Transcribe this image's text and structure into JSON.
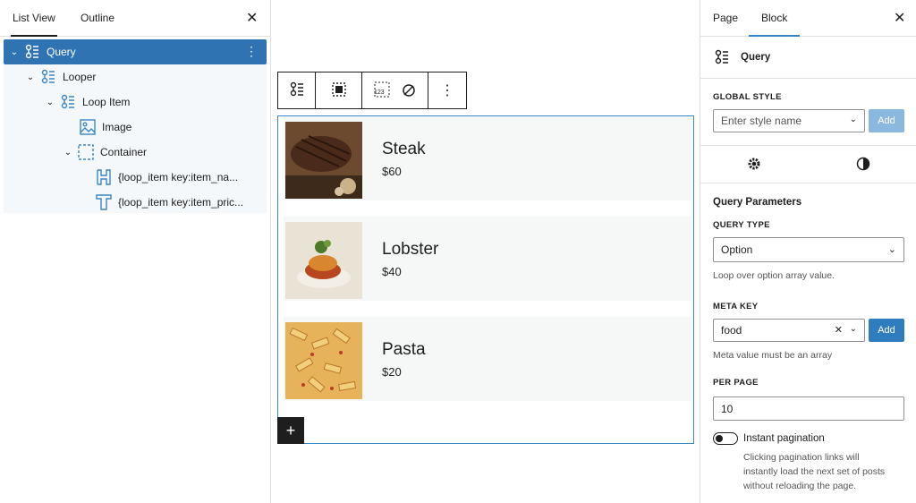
{
  "left_panel": {
    "tabs": [
      "List View",
      "Outline"
    ],
    "close_symbol": "✕",
    "tree": [
      {
        "label": "Query",
        "icon": "query-icon",
        "chevron": "⌄",
        "selected": true
      },
      {
        "label": "Looper",
        "icon": "looper-icon",
        "chevron": "⌄"
      },
      {
        "label": "Loop Item",
        "icon": "loop-item-icon",
        "chevron": "⌄"
      },
      {
        "label": "Image",
        "icon": "image-icon",
        "chevron": ""
      },
      {
        "label": "Container",
        "icon": "container-icon",
        "chevron": "⌄"
      },
      {
        "label": "{loop_item key:item_na...",
        "icon": "heading-icon",
        "chevron": ""
      },
      {
        "label": "{loop_item key:item_pric...",
        "icon": "text-icon",
        "chevron": ""
      }
    ],
    "more_symbol": "⋮"
  },
  "canvas": {
    "toolbar_more": "⋮",
    "add_symbol": "+",
    "items": [
      {
        "title": "Steak",
        "price": "$60"
      },
      {
        "title": "Lobster",
        "price": "$40"
      },
      {
        "title": "Pasta",
        "price": "$20"
      }
    ]
  },
  "sidebar": {
    "tabs": [
      "Page",
      "Block"
    ],
    "close_symbol": "✕",
    "block_name": "Query",
    "global_style_label": "GLOBAL STYLE",
    "style_placeholder": "Enter style name",
    "add_label": "Add",
    "query_params_title": "Query Parameters",
    "query_type_label": "QUERY TYPE",
    "query_type_value": "Option",
    "query_type_help": "Loop over option array value.",
    "meta_key_label": "META KEY",
    "meta_key_value": "food",
    "meta_key_help": "Meta value must be an array",
    "per_page_label": "PER PAGE",
    "per_page_value": "10",
    "instant_pagination_label": "Instant pagination",
    "instant_help_1": "Clicking pagination links will",
    "instant_help_2": "instantly load the next set of posts",
    "instant_help_3": "without reloading the page.",
    "clear_symbol": "✕",
    "chevron": "⌄"
  },
  "colors": {
    "accent": "#2f73b3",
    "frame": "#3a86c5",
    "selected_row": "#2f73b3"
  }
}
